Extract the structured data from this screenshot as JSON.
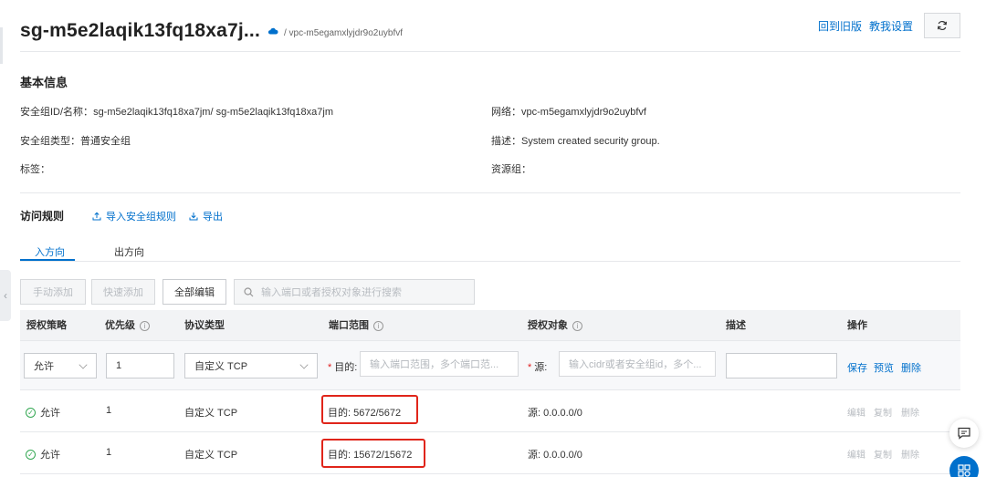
{
  "header": {
    "title": "sg-m5e2laqik13fq18xa7j...",
    "sub_path": "/ vpc-m5egamxlyjdr9o2uybfvf",
    "links": [
      "回到旧版",
      "教我设置"
    ]
  },
  "basic_info": {
    "title": "基本信息",
    "sg_id_label": "安全组ID/名称：",
    "sg_id_value": "sg-m5e2laqik13fq18xa7jm/ sg-m5e2laqik13fq18xa7jm",
    "network_label": "网络：",
    "network_value": "vpc-m5egamxlyjdr9o2uybfvf",
    "type_label": "安全组类型：",
    "type_value": "普通安全组",
    "desc_label": "描述：",
    "desc_value": "System created security group.",
    "tags_label": "标签：",
    "resource_group_label": "资源组："
  },
  "rules": {
    "title": "访问规则",
    "import_label": "导入安全组规则",
    "export_label": "导出",
    "tabs": [
      "入方向",
      "出方向"
    ],
    "toolbar": {
      "manual_add": "手动添加",
      "quick_add": "快速添加",
      "edit_all": "全部编辑",
      "search_placeholder": "输入端口或者授权对象进行搜索"
    },
    "columns": [
      "授权策略",
      "优先级",
      "协议类型",
      "端口范围",
      "授权对象",
      "描述",
      "操作"
    ],
    "edit_row": {
      "policy": "允许",
      "priority": "1",
      "protocol": "自定义 TCP",
      "dest_label": "目的:",
      "dest_placeholder": "输入端口范围，多个端口范...",
      "src_label": "源:",
      "src_placeholder": "输入cidr或者安全组id，多个...",
      "ops": [
        "保存",
        "预览",
        "删除"
      ]
    },
    "rows": [
      {
        "policy": "允许",
        "priority": "1",
        "protocol": "自定义 TCP",
        "port": "目的: 5672/5672",
        "source": "源: 0.0.0.0/0",
        "ops": [
          "编辑",
          "复制",
          "删除"
        ]
      },
      {
        "policy": "允许",
        "priority": "1",
        "protocol": "自定义 TCP",
        "port": "目的: 15672/15672",
        "source": "源: 0.0.0.0/0",
        "ops": [
          "编辑",
          "复制",
          "删除"
        ]
      }
    ]
  },
  "colors": {
    "accent": "#0070cc",
    "highlight": "#e0251a",
    "success": "#34a853"
  }
}
